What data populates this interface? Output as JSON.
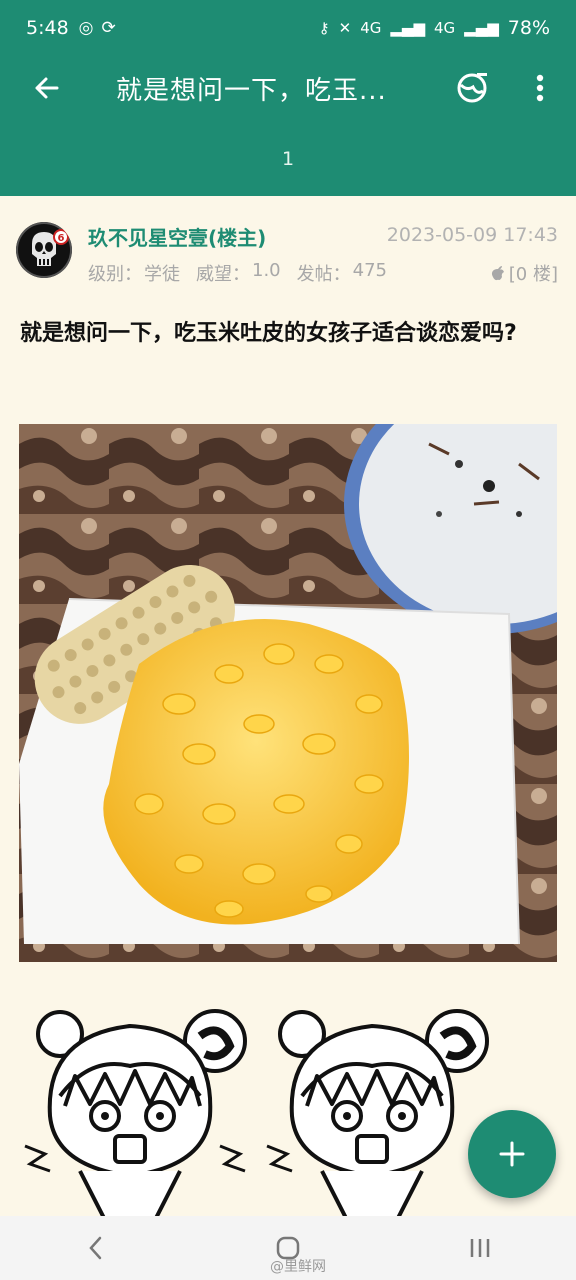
{
  "status_bar": {
    "time": "5:48",
    "network_1": "4G",
    "network_2": "4G",
    "battery": "78%"
  },
  "app_bar": {
    "title": "就是想问一下，吃玉...",
    "page_number": "1"
  },
  "post": {
    "author": "玖不见星空壹(楼主)",
    "date": "2023-05-09 17:43",
    "level_label": "级别：",
    "level_value": "学徒",
    "prestige_label": "威望：",
    "prestige_value": "1.0",
    "posts_label": "发帖：",
    "posts_value": "475",
    "floor": "[0 楼]",
    "avatar_badge": "6",
    "body": "就是想问一下，吃玉米吐皮的女孩子适合谈恋爱吗?"
  },
  "watermark": "@里鲜网",
  "colors": {
    "primary": "#1e8c73",
    "background": "#fcf7e8"
  }
}
